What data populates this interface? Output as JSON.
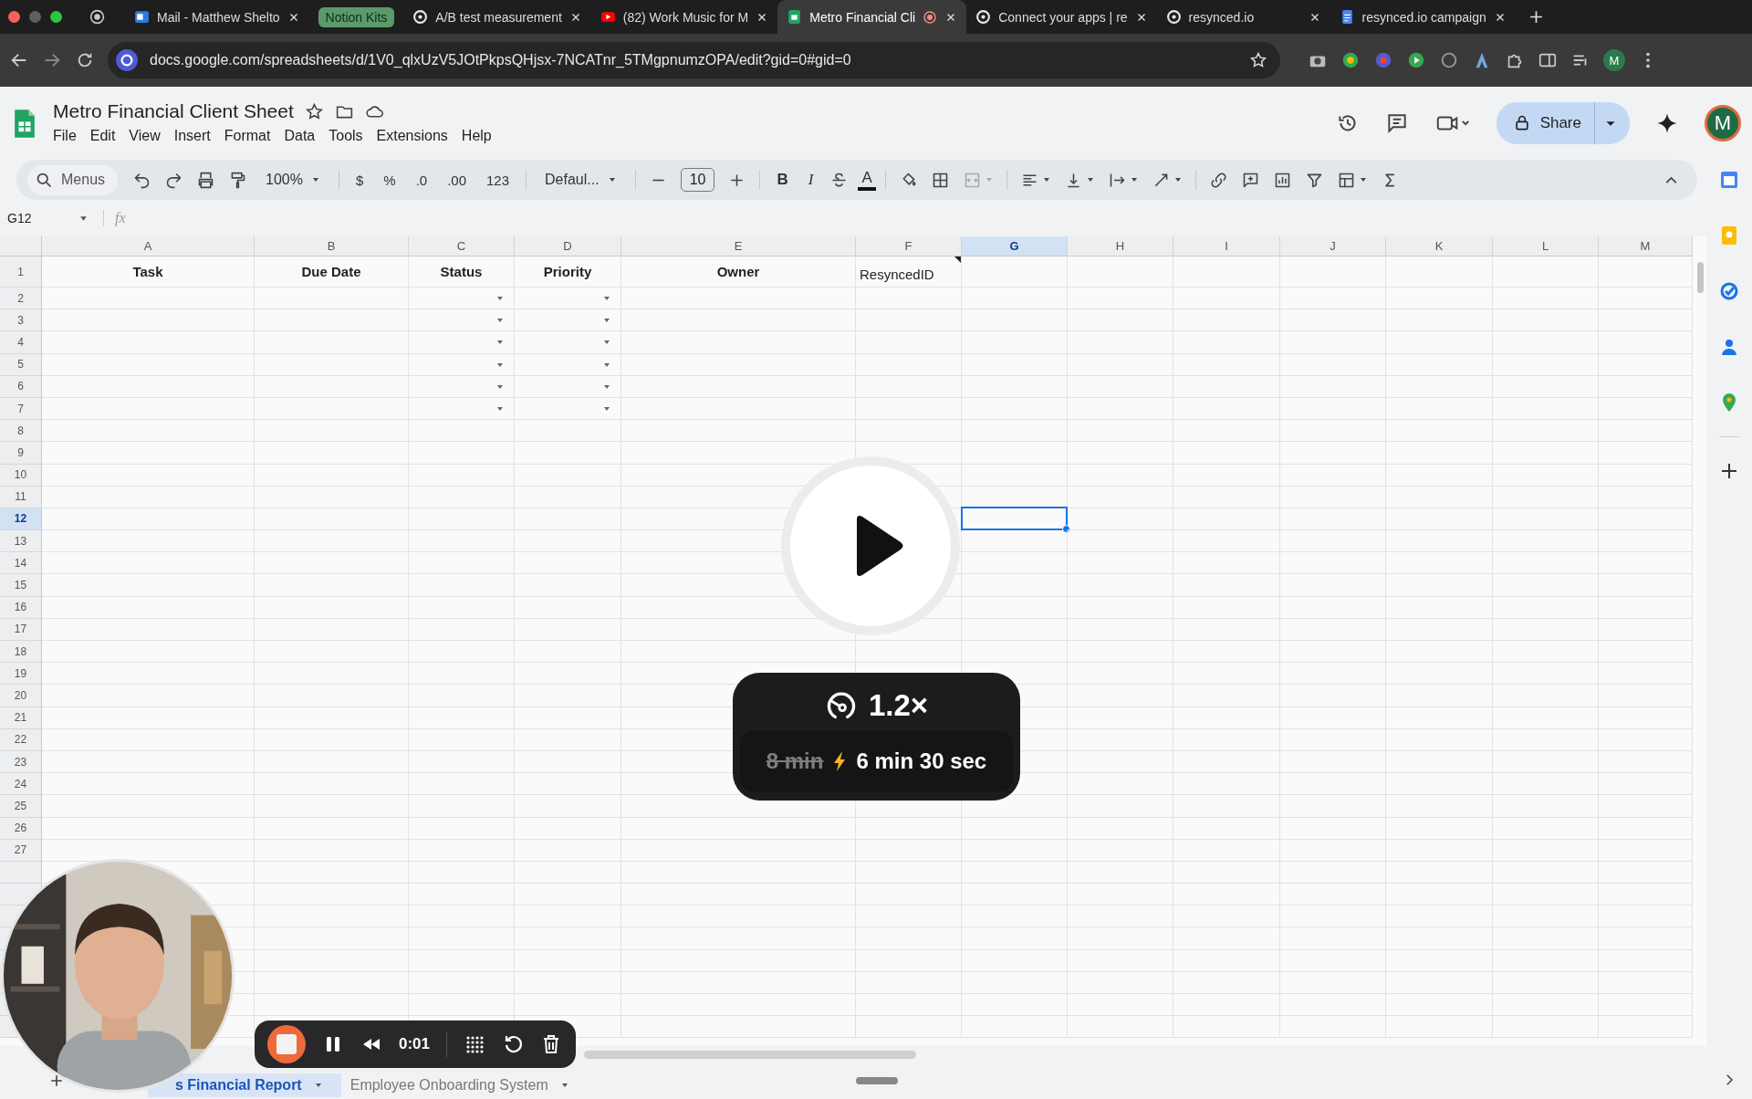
{
  "browser": {
    "tabs": [
      {
        "kind": "tab",
        "title": "Mail - Matthew Shelto",
        "selected": false,
        "recording": false
      },
      {
        "kind": "group",
        "title": "Notion Kits"
      },
      {
        "kind": "tab",
        "title": "A/B test measurement",
        "selected": false,
        "recording": false
      },
      {
        "kind": "tab",
        "title": "(82) Work Music for M",
        "selected": false,
        "recording": false
      },
      {
        "kind": "tab",
        "title": "Metro Financial Cli",
        "selected": true,
        "recording": true
      },
      {
        "kind": "tab",
        "title": "Connect your apps | re",
        "selected": false,
        "recording": false
      },
      {
        "kind": "tab",
        "title": "resynced.io",
        "selected": false,
        "recording": false
      },
      {
        "kind": "tab",
        "title": "resynced.io campaign",
        "selected": false,
        "recording": false
      }
    ],
    "url": "docs.google.com/spreadsheets/d/1V0_qlxUzV5JOtPkpsQHjsx-7NCATnr_5TMgpnumzOPA/edit?gid=0#gid=0",
    "profile": "M"
  },
  "sheets": {
    "title": "Metro Financial Client Sheet",
    "menus": [
      "File",
      "Edit",
      "View",
      "Insert",
      "Format",
      "Data",
      "Tools",
      "Extensions",
      "Help"
    ],
    "share": "Share",
    "avatar": "M",
    "toolbar": [
      {
        "kind": "search",
        "label": "Menus"
      },
      {
        "kind": "icon"
      },
      {
        "kind": "icon"
      },
      {
        "kind": "icon"
      },
      {
        "kind": "icon"
      },
      {
        "kind": "dropdown",
        "label": "100%"
      },
      {
        "kind": "sep"
      },
      {
        "kind": "text",
        "label": "$"
      },
      {
        "kind": "text",
        "label": "%"
      },
      {
        "kind": "text",
        "label": ".0"
      },
      {
        "kind": "text",
        "label": ".00"
      },
      {
        "kind": "text",
        "label": "123"
      },
      {
        "kind": "sep"
      },
      {
        "kind": "dropdown",
        "label": "Defaul..."
      },
      {
        "kind": "sep"
      },
      {
        "kind": "icon"
      },
      {
        "kind": "size",
        "label": "10"
      },
      {
        "kind": "icon"
      },
      {
        "kind": "sep"
      },
      {
        "kind": "bold",
        "label": "B"
      },
      {
        "kind": "italic",
        "label": "I"
      },
      {
        "kind": "icon"
      },
      {
        "kind": "underline",
        "label": "A"
      },
      {
        "kind": "sep"
      },
      {
        "kind": "icon"
      },
      {
        "kind": "icon"
      },
      {
        "kind": "icon",
        "disabled": true
      },
      {
        "kind": "sep"
      },
      {
        "kind": "icon",
        "menu": true
      },
      {
        "kind": "icon",
        "menu": true
      },
      {
        "kind": "icon",
        "menu": true
      },
      {
        "kind": "icon",
        "menu": true
      },
      {
        "kind": "sep"
      },
      {
        "kind": "icon"
      },
      {
        "kind": "icon"
      },
      {
        "kind": "icon"
      },
      {
        "kind": "icon"
      },
      {
        "kind": "icon",
        "menu": true
      },
      {
        "kind": "icon"
      }
    ],
    "name_box": "G12",
    "fx": "fx",
    "columns": [
      {
        "label": "A",
        "selected": false,
        "validation": false
      },
      {
        "label": "B",
        "selected": false,
        "validation": false
      },
      {
        "label": "C",
        "selected": false,
        "validation": true
      },
      {
        "label": "D",
        "selected": false,
        "validation": true
      },
      {
        "label": "E",
        "selected": false,
        "validation": false
      },
      {
        "label": "F",
        "selected": false,
        "validation": false
      },
      {
        "label": "G",
        "selected": true,
        "validation": false
      },
      {
        "label": "H",
        "selected": false,
        "validation": false
      },
      {
        "label": "I",
        "selected": false,
        "validation": false
      },
      {
        "label": "J",
        "selected": false,
        "validation": false
      },
      {
        "label": "K",
        "selected": false,
        "validation": false
      },
      {
        "label": "L",
        "selected": false,
        "validation": false
      },
      {
        "label": "M",
        "selected": false,
        "validation": false
      }
    ],
    "header_row": [
      {
        "text": "Task",
        "bold": true,
        "note": false
      },
      {
        "text": "Due Date",
        "bold": true,
        "note": false
      },
      {
        "text": "Status",
        "bold": true,
        "note": false
      },
      {
        "text": "Priority",
        "bold": true,
        "note": false
      },
      {
        "text": "Owner",
        "bold": true,
        "note": false
      },
      {
        "text": "ResyncedID",
        "bold": false,
        "note": true
      }
    ],
    "rows": [
      {
        "label": "1",
        "selected": false,
        "dropdowns": false
      },
      {
        "label": "2",
        "selected": false,
        "dropdowns": true
      },
      {
        "label": "3",
        "selected": false,
        "dropdowns": true
      },
      {
        "label": "4",
        "selected": false,
        "dropdowns": true
      },
      {
        "label": "5",
        "selected": false,
        "dropdowns": true
      },
      {
        "label": "6",
        "selected": false,
        "dropdowns": true
      },
      {
        "label": "7",
        "selected": false,
        "dropdowns": true
      },
      {
        "label": "8",
        "selected": false,
        "dropdowns": false
      },
      {
        "label": "9",
        "selected": false,
        "dropdowns": false
      },
      {
        "label": "10",
        "selected": false,
        "dropdowns": false
      },
      {
        "label": "11",
        "selected": false,
        "dropdowns": false
      },
      {
        "label": "12",
        "selected": true,
        "dropdowns": false
      },
      {
        "label": "13",
        "selected": false,
        "dropdowns": false
      },
      {
        "label": "14",
        "selected": false,
        "dropdowns": false
      },
      {
        "label": "15",
        "selected": false,
        "dropdowns": false
      },
      {
        "label": "16",
        "selected": false,
        "dropdowns": false
      },
      {
        "label": "17",
        "selected": false,
        "dropdowns": false
      },
      {
        "label": "18",
        "selected": false,
        "dropdowns": false
      },
      {
        "label": "19",
        "selected": false,
        "dropdowns": false
      },
      {
        "label": "20",
        "selected": false,
        "dropdowns": false
      },
      {
        "label": "21",
        "selected": false,
        "dropdowns": false
      },
      {
        "label": "22",
        "selected": false,
        "dropdowns": false
      },
      {
        "label": "23",
        "selected": false,
        "dropdowns": false
      },
      {
        "label": "24",
        "selected": false,
        "dropdowns": false
      },
      {
        "label": "25",
        "selected": false,
        "dropdowns": false
      },
      {
        "label": "26",
        "selected": false,
        "dropdowns": false
      },
      {
        "label": "27",
        "selected": false,
        "dropdowns": false
      }
    ],
    "sheet_tabs": [
      {
        "label": "s Financial Report",
        "selected": true
      },
      {
        "label": "Employee Onboarding System",
        "selected": false
      }
    ]
  },
  "player": {
    "speed": "1.2×",
    "original_time": "8 min",
    "new_time": "6 min 30 sec"
  },
  "recorder": {
    "time": "0:01"
  }
}
